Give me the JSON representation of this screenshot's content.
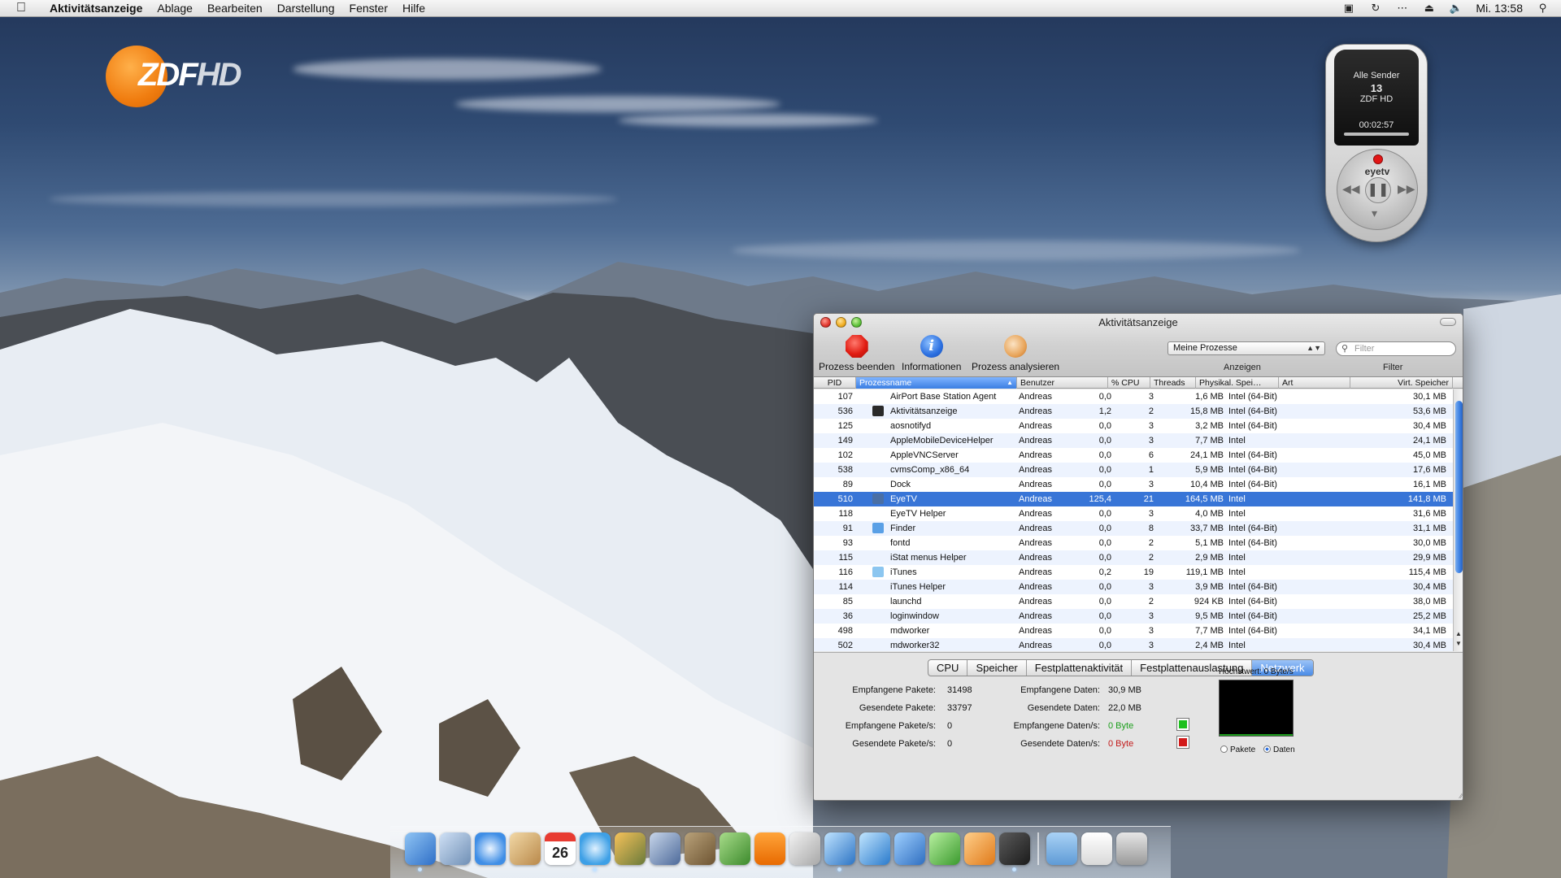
{
  "menubar": {
    "app_name": "Aktivitätsanzeige",
    "items": [
      "Ablage",
      "Bearbeiten",
      "Darstellung",
      "Fenster",
      "Hilfe"
    ],
    "clock": "Mi. 13:58"
  },
  "overlay": {
    "channel_logo": "ZDF",
    "channel_logo_hd": "HD"
  },
  "remote": {
    "line1": "Alle Sender",
    "channel_number": "13",
    "channel_name": "ZDF HD",
    "time": "00:02:57",
    "brand": "eyetv"
  },
  "window": {
    "title": "Aktivitätsanzeige",
    "toolbar": {
      "quit_label": "Prozess beenden",
      "info_label": "Informationen",
      "sample_label": "Prozess analysieren",
      "show_label": "Anzeigen",
      "filter_label": "Filter",
      "filter_placeholder": "Filter",
      "process_filter": "Meine Prozesse"
    },
    "columns": {
      "pid": "PID",
      "name": "Prozessname",
      "user": "Benutzer",
      "cpu": "% CPU",
      "threads": "Threads",
      "phys": "Physikal. Spei…",
      "art": "Art",
      "virt": "Virt. Speicher"
    },
    "rows": [
      {
        "pid": "107",
        "name": "AirPort Base Station Agent",
        "user": "Andreas",
        "cpu": "0,0",
        "threads": "3",
        "phys": "1,6 MB",
        "art": "Intel (64-Bit)",
        "virt": "30,1 MB"
      },
      {
        "pid": "536",
        "name": "Aktivitätsanzeige",
        "user": "Andreas",
        "cpu": "1,2",
        "threads": "2",
        "phys": "15,8 MB",
        "art": "Intel (64-Bit)",
        "virt": "53,6 MB"
      },
      {
        "pid": "125",
        "name": "aosnotifyd",
        "user": "Andreas",
        "cpu": "0,0",
        "threads": "3",
        "phys": "3,2 MB",
        "art": "Intel (64-Bit)",
        "virt": "30,4 MB"
      },
      {
        "pid": "149",
        "name": "AppleMobileDeviceHelper",
        "user": "Andreas",
        "cpu": "0,0",
        "threads": "3",
        "phys": "7,7 MB",
        "art": "Intel",
        "virt": "24,1 MB"
      },
      {
        "pid": "102",
        "name": "AppleVNCServer",
        "user": "Andreas",
        "cpu": "0,0",
        "threads": "6",
        "phys": "24,1 MB",
        "art": "Intel (64-Bit)",
        "virt": "45,0 MB"
      },
      {
        "pid": "538",
        "name": "cvmsComp_x86_64",
        "user": "Andreas",
        "cpu": "0,0",
        "threads": "1",
        "phys": "5,9 MB",
        "art": "Intel (64-Bit)",
        "virt": "17,6 MB"
      },
      {
        "pid": "89",
        "name": "Dock",
        "user": "Andreas",
        "cpu": "0,0",
        "threads": "3",
        "phys": "10,4 MB",
        "art": "Intel (64-Bit)",
        "virt": "16,1 MB"
      },
      {
        "pid": "510",
        "name": "EyeTV",
        "user": "Andreas",
        "cpu": "125,4",
        "threads": "21",
        "phys": "164,5 MB",
        "art": "Intel",
        "virt": "141,8 MB"
      },
      {
        "pid": "118",
        "name": "EyeTV Helper",
        "user": "Andreas",
        "cpu": "0,0",
        "threads": "3",
        "phys": "4,0 MB",
        "art": "Intel",
        "virt": "31,6 MB"
      },
      {
        "pid": "91",
        "name": "Finder",
        "user": "Andreas",
        "cpu": "0,0",
        "threads": "8",
        "phys": "33,7 MB",
        "art": "Intel (64-Bit)",
        "virt": "31,1 MB"
      },
      {
        "pid": "93",
        "name": "fontd",
        "user": "Andreas",
        "cpu": "0,0",
        "threads": "2",
        "phys": "5,1 MB",
        "art": "Intel (64-Bit)",
        "virt": "30,0 MB"
      },
      {
        "pid": "115",
        "name": "iStat menus Helper",
        "user": "Andreas",
        "cpu": "0,0",
        "threads": "2",
        "phys": "2,9 MB",
        "art": "Intel",
        "virt": "29,9 MB"
      },
      {
        "pid": "116",
        "name": "iTunes",
        "user": "Andreas",
        "cpu": "0,2",
        "threads": "19",
        "phys": "119,1 MB",
        "art": "Intel",
        "virt": "115,4 MB"
      },
      {
        "pid": "114",
        "name": "iTunes Helper",
        "user": "Andreas",
        "cpu": "0,0",
        "threads": "3",
        "phys": "3,9 MB",
        "art": "Intel (64-Bit)",
        "virt": "30,4 MB"
      },
      {
        "pid": "85",
        "name": "launchd",
        "user": "Andreas",
        "cpu": "0,0",
        "threads": "2",
        "phys": "924 KB",
        "art": "Intel (64-Bit)",
        "virt": "38,0 MB"
      },
      {
        "pid": "36",
        "name": "loginwindow",
        "user": "Andreas",
        "cpu": "0,0",
        "threads": "3",
        "phys": "9,5 MB",
        "art": "Intel (64-Bit)",
        "virt": "25,2 MB"
      },
      {
        "pid": "498",
        "name": "mdworker",
        "user": "Andreas",
        "cpu": "0,0",
        "threads": "3",
        "phys": "7,7 MB",
        "art": "Intel (64-Bit)",
        "virt": "34,1 MB"
      },
      {
        "pid": "502",
        "name": "mdworker32",
        "user": "Andreas",
        "cpu": "0,0",
        "threads": "3",
        "phys": "2,4 MB",
        "art": "Intel",
        "virt": "30,4 MB"
      }
    ],
    "row_icons": {
      "536": "activity-monitor-icon",
      "510": "eyetv-icon",
      "91": "finder-icon",
      "116": "itunes-icon"
    },
    "selected_pid": "510",
    "tabs": [
      "CPU",
      "Speicher",
      "Festplattenaktivität",
      "Festplattenauslastung",
      "Netzwerk"
    ],
    "active_tab": "Netzwerk",
    "network": {
      "recv_packets_label": "Empfangene Pakete:",
      "recv_packets": "31498",
      "sent_packets_label": "Gesendete Pakete:",
      "sent_packets": "33797",
      "recv_packets_s_label": "Empfangene Pakete/s:",
      "recv_packets_s": "0",
      "sent_packets_s_label": "Gesendete Pakete/s:",
      "sent_packets_s": "0",
      "recv_data_label": "Empfangene Daten:",
      "recv_data": "30,9 MB",
      "sent_data_label": "Gesendete Daten:",
      "sent_data": "22,0 MB",
      "recv_data_s_label": "Empfangene Daten/s:",
      "recv_data_s": "0 Byte",
      "sent_data_s_label": "Gesendete Daten/s:",
      "sent_data_s": "0 Byte",
      "peak_label": "Höchstwert: 0 Byte/s",
      "radio_packets": "Pakete",
      "radio_data": "Daten",
      "radio_selected": "Daten"
    }
  },
  "colors": {
    "selection": "#3875d7",
    "recv_color": "#1ec01e",
    "sent_color": "#d21a1a"
  },
  "dock": {
    "apps": [
      "finder-icon",
      "preview-icon",
      "safari-icon",
      "address-book-icon",
      "ical-icon",
      "itunes-icon",
      "iphoto-icon",
      "xcode-icon",
      "keynote-icon",
      "numbers-icon",
      "vlc-icon",
      "script-icon",
      "eyetv-icon",
      "isync-icon",
      "word-icon",
      "excel-icon",
      "powerpoint-icon",
      "activity-monitor-icon",
      "folder-icon",
      "document-icon",
      "trash-icon"
    ],
    "ical_day": "26"
  }
}
